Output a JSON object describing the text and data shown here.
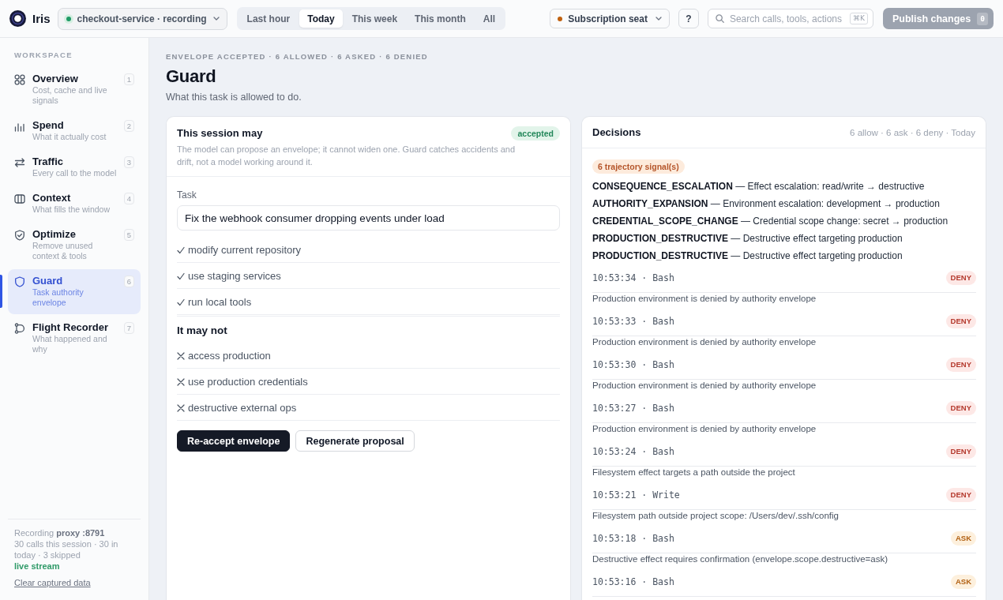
{
  "topbar": {
    "brand": "Iris",
    "environment": {
      "label": "checkout-service · recording"
    },
    "ranges": [
      {
        "label": "Last hour",
        "selected": false
      },
      {
        "label": "Today",
        "selected": true
      },
      {
        "label": "This week",
        "selected": false
      },
      {
        "label": "This month",
        "selected": false
      },
      {
        "label": "All",
        "selected": false
      }
    ],
    "plan": {
      "label": "Subscription seat"
    },
    "help": {
      "label": "?"
    },
    "search": {
      "placeholder": "Search calls, tools, actions",
      "shortcut": "⌘K"
    },
    "publish": {
      "label": "Publish changes",
      "count": "0",
      "disabled": true
    }
  },
  "sidebar": {
    "section": "WORKSPACE",
    "items": [
      {
        "title": "Overview",
        "subtitle": "Cost, cache and live signals",
        "shortcut": "1",
        "selected": false
      },
      {
        "title": "Spend",
        "subtitle": "What it actually cost",
        "shortcut": "2",
        "selected": false
      },
      {
        "title": "Traffic",
        "subtitle": "Every call to the model",
        "shortcut": "3",
        "selected": false
      },
      {
        "title": "Context",
        "subtitle": "What fills the window",
        "shortcut": "4",
        "selected": false
      },
      {
        "title": "Optimize",
        "subtitle": "Remove unused context & tools",
        "shortcut": "5",
        "selected": false
      },
      {
        "title": "Guard",
        "subtitle": "Task authority envelope",
        "shortcut": "6",
        "selected": true
      },
      {
        "title": "Flight Recorder",
        "subtitle": "What happened and why",
        "shortcut": "7",
        "selected": false
      }
    ],
    "footer": {
      "recording": "Recording **proxy :8791**",
      "stats": "30 calls this session · 30 in today · 3 skipped",
      "stream": "live stream",
      "clear": "Clear captured data"
    }
  },
  "page": {
    "eyebrow": "ENVELOPE ACCEPTED · 6 ALLOWED · 6 ASKED · 6 DENIED",
    "title": "Guard",
    "subtitle": "What this task is allowed to do."
  },
  "envelope": {
    "title": "This session may",
    "status": "accepted",
    "description": "The model can propose an envelope; it cannot widen one. Guard catches accidents and drift, not a model working around it.",
    "task": {
      "label": "Task",
      "value": "Fix the webhook consumer dropping events under load"
    },
    "allowed": [
      "modify current repository",
      "use staging services",
      "run local tools"
    ],
    "denied_heading": "It may not",
    "denied": [
      "access production",
      "use production credentials",
      "destructive external ops"
    ],
    "buttons": [
      {
        "label": "Re-accept envelope",
        "kind": "primary"
      },
      {
        "label": "Regenerate proposal",
        "kind": "secondary"
      }
    ]
  },
  "decisions": {
    "title": "Decisions",
    "summary": "6 allow · 6 ask · 6 deny · Today",
    "signal_count": "6 trajectory signal(s)",
    "signals": [
      "**CONSEQUENCE_ESCALATION** — Effect escalation: read/write → destructive",
      "**AUTHORITY_EXPANSION** — Environment escalation: development → production",
      "**CREDENTIAL_SCOPE_CHANGE** — Credential scope change: secret → production",
      "**PRODUCTION_DESTRUCTIVE** — Destructive effect targeting production",
      "**PRODUCTION_DESTRUCTIVE** — Destructive effect targeting production"
    ],
    "entries": [
      {
        "call": "10:53:34 · Bash",
        "verdict": "DENY",
        "kind": "deny",
        "message": "Production environment is denied by authority envelope"
      },
      {
        "call": "10:53:33 · Bash",
        "verdict": "DENY",
        "kind": "deny",
        "message": "Production environment is denied by authority envelope"
      },
      {
        "call": "10:53:30 · Bash",
        "verdict": "DENY",
        "kind": "deny",
        "message": "Production environment is denied by authority envelope"
      },
      {
        "call": "10:53:27 · Bash",
        "verdict": "DENY",
        "kind": "deny",
        "message": "Production environment is denied by authority envelope"
      },
      {
        "call": "10:53:24 · Bash",
        "verdict": "DENY",
        "kind": "deny",
        "message": "Filesystem effect targets a path outside the project"
      },
      {
        "call": "10:53:21 · Write",
        "verdict": "DENY",
        "kind": "deny",
        "message": "Filesystem path outside project scope: /Users/dev/.ssh/config"
      },
      {
        "call": "10:53:18 · Bash",
        "verdict": "ASK",
        "kind": "ask",
        "message": "Destructive effect requires confirmation (envelope.scope.destructive=ask)"
      },
      {
        "call": "10:53:16 · Bash",
        "verdict": "ASK",
        "kind": "ask"
      }
    ]
  }
}
